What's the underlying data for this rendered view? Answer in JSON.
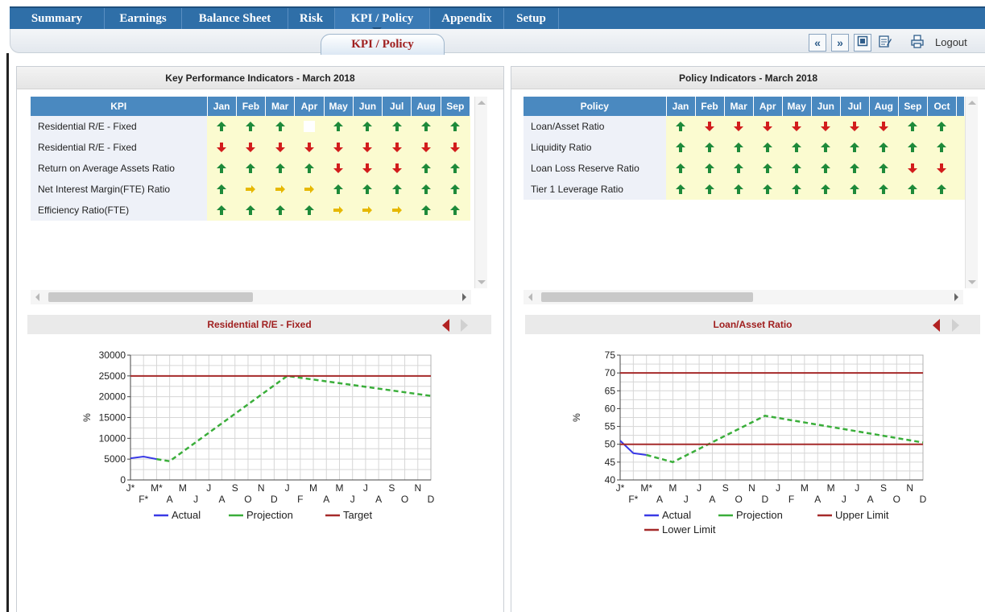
{
  "nav": {
    "tabs": [
      "Summary",
      "Earnings",
      "Balance Sheet",
      "Risk",
      "KPI / Policy",
      "Appendix",
      "Setup"
    ],
    "active_tab": "KPI / Policy",
    "subtab": "KPI / Policy",
    "logout": "Logout",
    "toolbar_icons": [
      "first-icon",
      "last-icon",
      "calculator-icon",
      "edit-icon",
      "print-icon"
    ]
  },
  "colors": {
    "nav_bar": "#2f6fa8",
    "header_blue": "#4a89c0",
    "cell_yellow": "#fbfbd0",
    "arrow_up": "#1e8a3a",
    "arrow_down": "#d21c1c",
    "arrow_right": "#e6b800",
    "actual": "#3a3ae6",
    "projection": "#3aae3a",
    "target": "#a52a2a"
  },
  "kpi": {
    "title": "Key Performance Indicators - March 2018",
    "name_header": "KPI",
    "months": [
      "Jan",
      "Feb",
      "Mar",
      "Apr",
      "May",
      "Jun",
      "Jul",
      "Aug",
      "Sep"
    ],
    "rows": [
      {
        "name": "Residential R/E - Fixed",
        "status": [
          "up",
          "up",
          "up",
          "blank",
          "up",
          "up",
          "up",
          "up",
          "up"
        ]
      },
      {
        "name": "Residential R/E - Fixed",
        "status": [
          "down",
          "down",
          "down",
          "down",
          "down",
          "down",
          "down",
          "down",
          "down"
        ]
      },
      {
        "name": "Return on Average Assets Ratio",
        "status": [
          "up",
          "up",
          "up",
          "up",
          "down",
          "down",
          "down",
          "up",
          "up"
        ]
      },
      {
        "name": "Net Interest Margin(FTE) Ratio",
        "status": [
          "up",
          "right",
          "right",
          "right",
          "up",
          "up",
          "up",
          "up",
          "up"
        ]
      },
      {
        "name": "Efficiency Ratio(FTE)",
        "status": [
          "up",
          "up",
          "up",
          "up",
          "right",
          "right",
          "right",
          "up",
          "up"
        ]
      }
    ]
  },
  "policy": {
    "title": "Policy Indicators - March 2018",
    "name_header": "Policy",
    "months": [
      "Jan",
      "Feb",
      "Mar",
      "Apr",
      "May",
      "Jun",
      "Jul",
      "Aug",
      "Sep",
      "Oct"
    ],
    "rows": [
      {
        "name": "Loan/Asset Ratio",
        "status": [
          "up",
          "down",
          "down",
          "down",
          "down",
          "down",
          "down",
          "down",
          "up",
          "up"
        ]
      },
      {
        "name": "Liquidity Ratio",
        "status": [
          "up",
          "up",
          "up",
          "up",
          "up",
          "up",
          "up",
          "up",
          "up",
          "up"
        ]
      },
      {
        "name": "Loan Loss Reserve Ratio",
        "status": [
          "up",
          "up",
          "up",
          "up",
          "up",
          "up",
          "up",
          "up",
          "down",
          "down"
        ]
      },
      {
        "name": "Tier 1 Leverage Ratio",
        "status": [
          "up",
          "up",
          "up",
          "up",
          "up",
          "up",
          "up",
          "up",
          "up",
          "up"
        ]
      }
    ]
  },
  "chart_data": [
    {
      "type": "line",
      "title": "Residential R/E - Fixed",
      "ylabel": "%",
      "ylim": [
        0,
        30000
      ],
      "yticks": [
        0,
        5000,
        10000,
        15000,
        20000,
        25000,
        30000
      ],
      "xlabels_top": [
        "J*",
        "M*",
        "M",
        "J",
        "S",
        "N",
        "J",
        "M",
        "M",
        "J",
        "S",
        "N"
      ],
      "xlabels_bottom": [
        "F*",
        "A",
        "J",
        "A",
        "O",
        "D",
        "F",
        "A",
        "J",
        "A",
        "O",
        "D"
      ],
      "x_count": 24,
      "grid": true,
      "legend_position": "bottom",
      "series": [
        {
          "name": "Actual",
          "style": "solid",
          "points": [
            [
              0,
              5200
            ],
            [
              1,
              5600
            ],
            [
              2,
              5000
            ]
          ]
        },
        {
          "name": "Projection",
          "style": "dashed",
          "points": [
            [
              2,
              5000
            ],
            [
              3,
              4500
            ],
            [
              12,
              25000
            ],
            [
              23,
              20200
            ]
          ]
        },
        {
          "name": "Target",
          "style": "solid",
          "points": [
            [
              0,
              25000
            ],
            [
              23,
              25000
            ]
          ]
        }
      ]
    },
    {
      "type": "line",
      "title": "Loan/Asset Ratio",
      "ylabel": "%",
      "ylim": [
        40,
        75
      ],
      "yticks": [
        40,
        45,
        50,
        55,
        60,
        65,
        70,
        75
      ],
      "xlabels_top": [
        "J*",
        "M*",
        "M",
        "J",
        "S",
        "N",
        "J",
        "M",
        "M",
        "J",
        "S",
        "N"
      ],
      "xlabels_bottom": [
        "F*",
        "A",
        "J",
        "A",
        "O",
        "D",
        "F",
        "A",
        "J",
        "A",
        "O",
        "D"
      ],
      "x_count": 24,
      "grid": true,
      "legend_position": "bottom",
      "series": [
        {
          "name": "Actual",
          "style": "solid",
          "points": [
            [
              0,
              51
            ],
            [
              1,
              47.5
            ],
            [
              2,
              47
            ]
          ]
        },
        {
          "name": "Projection",
          "style": "dashed",
          "points": [
            [
              2,
              47
            ],
            [
              4,
              45
            ],
            [
              11,
              58
            ],
            [
              23,
              50.5
            ]
          ]
        },
        {
          "name": "Upper Limit",
          "style": "solid",
          "points": [
            [
              0,
              70
            ],
            [
              23,
              70
            ]
          ]
        },
        {
          "name": "Lower Limit",
          "style": "solid",
          "points": [
            [
              0,
              50
            ],
            [
              23,
              50
            ]
          ]
        }
      ]
    }
  ]
}
